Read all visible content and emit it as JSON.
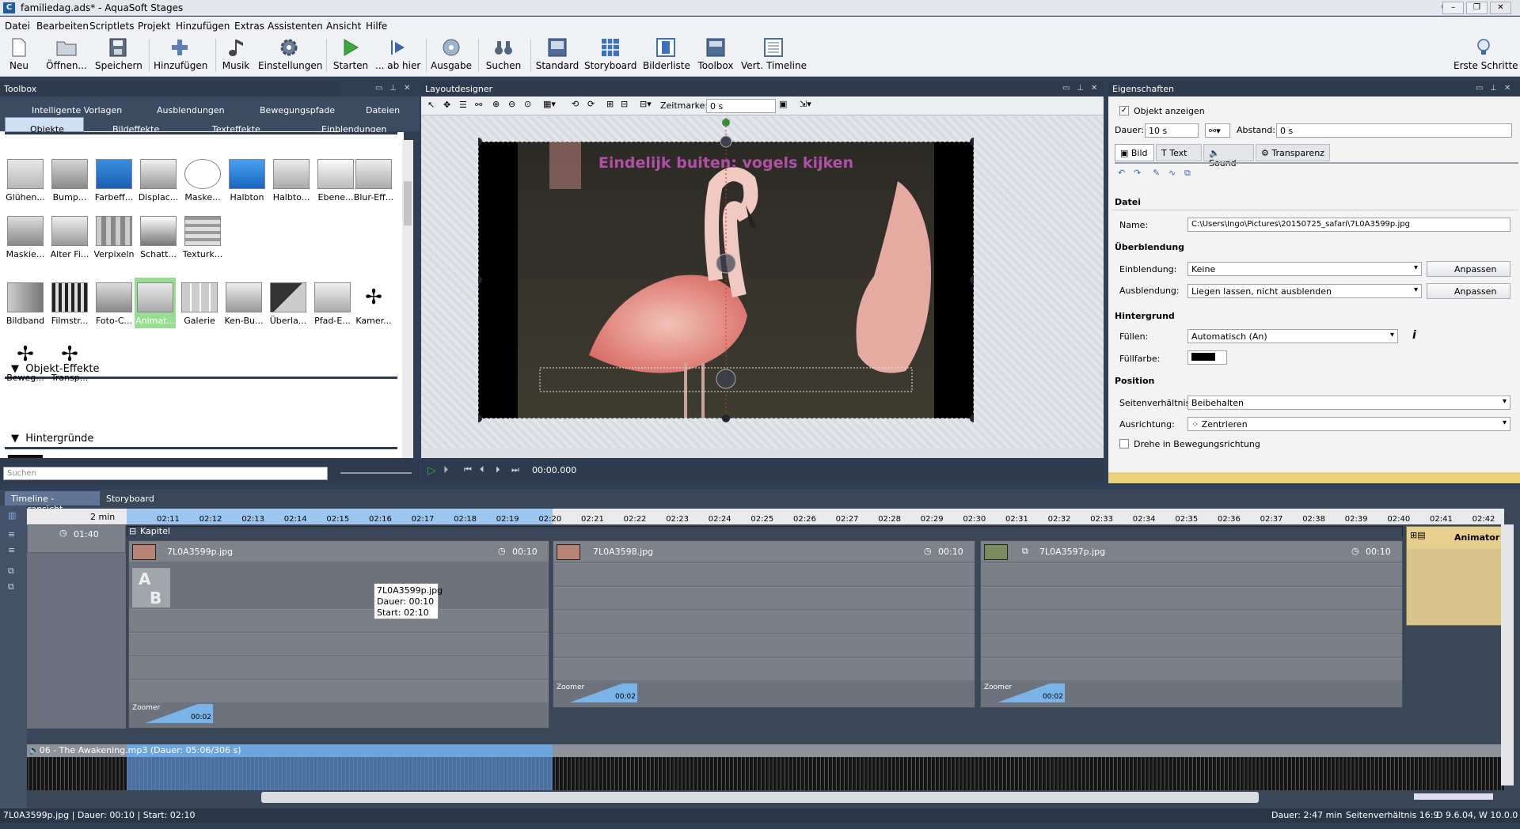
{
  "window": {
    "title": "familiedag.ads* - AquaSoft Stages"
  },
  "menu": [
    "Datei",
    "Bearbeiten",
    "Scriptlets",
    "Projekt",
    "Hinzufügen",
    "Extras",
    "Assistenten",
    "Ansicht",
    "Hilfe"
  ],
  "toolbar": {
    "neu": "Neu",
    "oeffnen": "Öffnen...",
    "speichern": "Speichern",
    "hinzufuegen": "Hinzufügen",
    "musik": "Musik",
    "einstellungen": "Einstellungen",
    "starten": "Starten",
    "ab_hier": "... ab hier",
    "ausgabe": "Ausgabe",
    "suchen": "Suchen",
    "standard": "Standard",
    "storyboard": "Storyboard",
    "bilderliste": "Bilderliste",
    "toolbox": "Toolbox",
    "vert_timeline": "Vert. Timeline",
    "erste_schritte": "Erste Schritte"
  },
  "toolbox": {
    "title": "Toolbox",
    "tabs_row1": [
      "Intelligente Vorlagen",
      "Ausblendungen",
      "Bewegungspfade",
      "Dateien"
    ],
    "tabs_row2": [
      "Objekte",
      "Bildeffekte",
      "Texteffekte",
      "Einblendungen"
    ],
    "live_effects": [
      "Glühen...",
      "Bump...",
      "Farbeff...",
      "Displac...",
      "Maske...",
      "Halbton",
      "Halbto...",
      "Ebene...",
      "Blur-Eff...",
      "Maskie...",
      "Alter Fi...",
      "Verpixeln",
      "Schatt...",
      "Texturk..."
    ],
    "object_effects_title": "Objekt-Effekte",
    "object_effects": [
      "Bildband",
      "Filmstr...",
      "Foto-C...",
      "Animat...",
      "Galerie",
      "Ken-Bu...",
      "Überla...",
      "Pfad-E...",
      "Kamer...",
      "Beweg...",
      "Transp..."
    ],
    "backgrounds_title": "Hintergründe",
    "search_placeholder": "Suchen"
  },
  "layout": {
    "title": "Layoutdesigner",
    "zeitmarke_label": "Zeitmarke:",
    "zeitmarke_value": "0 s",
    "overlay_text": "Eindelijk buiten: vogels kijken",
    "time": "00:00.000"
  },
  "props": {
    "title": "Eigenschaften",
    "objekt_anzeigen": "Objekt anzeigen",
    "dauer_label": "Dauer:",
    "dauer_value": "10 s",
    "abstand_label": "Abstand:",
    "abstand_value": "0 s",
    "tabs": [
      "Bild",
      "Text",
      "Sound",
      "Transparenz"
    ],
    "datei_section": "Datei",
    "name_label": "Name:",
    "name_value": "C:\\Users\\Ingo\\Pictures\\20150725_safari\\7L0A3599p.jpg",
    "ueberblendung_section": "Überblendung",
    "einblendung_label": "Einblendung:",
    "einblendung_value": "Keine",
    "ausblendung_label": "Ausblendung:",
    "ausblendung_value": "Liegen lassen, nicht ausblenden",
    "anpassen": "Anpassen",
    "hintergrund_section": "Hintergrund",
    "fuellen_label": "Füllen:",
    "fuellen_value": "Automatisch (An)",
    "fuellfarbe_label": "Füllfarbe:",
    "position_section": "Position",
    "seiten_label": "Seitenverhältnis:",
    "seiten_value": "Beibehalten",
    "ausrichtung_label": "Ausrichtung:",
    "ausrichtung_value": "Zentrieren",
    "drehe": "Drehe in Bewegungsrichtung"
  },
  "timeline": {
    "tabs": [
      "Timeline - Spuransicht",
      "Storyboard"
    ],
    "zoom_label": "2 min",
    "ruler": [
      "02:11",
      "02:12",
      "02:13",
      "02:14",
      "02:15",
      "02:16",
      "02:17",
      "02:18",
      "02:19",
      "02:20",
      "02:21",
      "02:22",
      "02:23",
      "02:24",
      "02:25",
      "02:26",
      "02:27",
      "02:28",
      "02:29",
      "02:30",
      "02:31",
      "02:32",
      "02:33",
      "02:34",
      "02:35",
      "02:36",
      "02:37",
      "02:38",
      "02:39",
      "02:40",
      "02:41",
      "02:42"
    ],
    "time_marker": "01:40",
    "chapter": "Kapitel",
    "clips": [
      {
        "name": "7L0A3599p.jpg",
        "dur": "00:10",
        "zoomer": "Zoomer",
        "zdur": "00:02"
      },
      {
        "name": "7L0A3598.jpg",
        "dur": "00:10",
        "zoomer": "Zoomer",
        "zdur": "00:02"
      },
      {
        "name": "7L0A3597p.jpg",
        "dur": "00:10",
        "zoomer": "Zoomer",
        "zdur": "00:02"
      }
    ],
    "animator": "Animator",
    "tooltip": {
      "line1": "7L0A3599p.jpg",
      "line2": "Dauer: 00:10",
      "line3": "Start: 02:10"
    },
    "audio": "06 - The Awakening.mp3 (Dauer: 05:06/306 s)"
  },
  "status": {
    "left": "7L0A3599p.jpg | Dauer: 00:10 | Start: 02:10",
    "dauer": "Dauer: 2:47 min",
    "seiten": "Seitenverhältnis 16:9",
    "version": "D 9.6.04, W 10.0.0"
  }
}
